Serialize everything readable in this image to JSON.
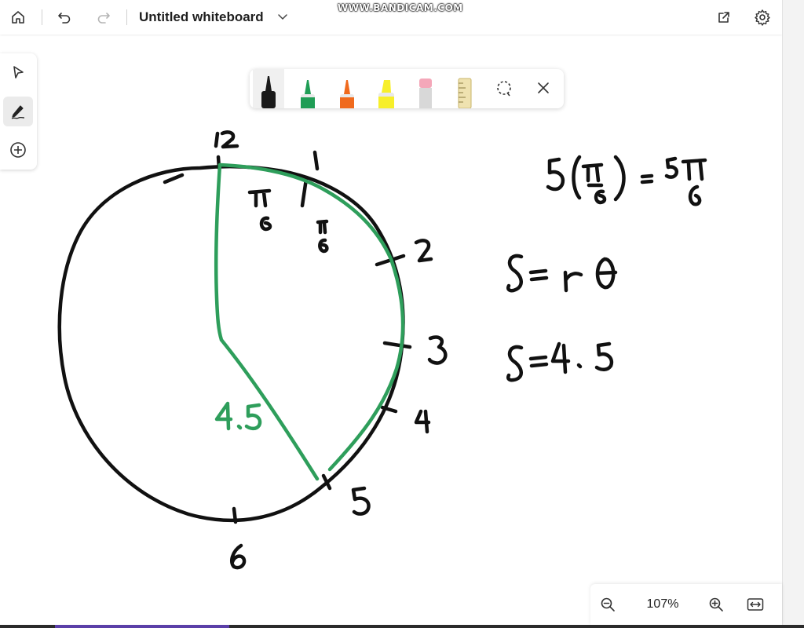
{
  "topbar": {
    "title": "Untitled whiteboard",
    "icons": [
      "home-icon",
      "undo-icon",
      "redo-icon",
      "chevron-down-icon",
      "share-icon",
      "gear-icon"
    ]
  },
  "watermark": "WWW.BANDICAM.COM",
  "left_rail": {
    "items": [
      {
        "name": "select-tool",
        "icon": "pointer-icon"
      },
      {
        "name": "draw-tool",
        "icon": "pen-icon",
        "active": true
      },
      {
        "name": "add-tool",
        "icon": "plus-circle-icon"
      }
    ]
  },
  "pen_toolbar": {
    "tools": [
      {
        "name": "black-pen",
        "color": "#1a1a1a",
        "active": true
      },
      {
        "name": "green-pen",
        "color": "#1f9d55"
      },
      {
        "name": "orange-pen",
        "color": "#f06a1d"
      },
      {
        "name": "yellow-highlighter",
        "color": "#f7ef2a"
      },
      {
        "name": "eraser",
        "color": "#f4a7b9"
      },
      {
        "name": "ruler",
        "color": "#e8d9a0"
      },
      {
        "name": "lasso-select",
        "icon": "lasso-icon"
      },
      {
        "name": "close",
        "icon": "close-icon"
      }
    ]
  },
  "drawing": {
    "ink_colors": {
      "black": "#111111",
      "green": "#2e9e5b"
    },
    "clock_labels": [
      "12",
      "1",
      "2",
      "3",
      "4",
      "5",
      "6"
    ],
    "arc_labels": [
      "π/6",
      "π/6"
    ],
    "radius_label": "4.5",
    "equations": [
      "5(π/6) = 5π/6",
      "S = r θ",
      "S = 4.5"
    ]
  },
  "zoom": {
    "level": "107%",
    "icons": [
      "zoom-out-icon",
      "zoom-in-icon",
      "fit-width-icon"
    ]
  }
}
